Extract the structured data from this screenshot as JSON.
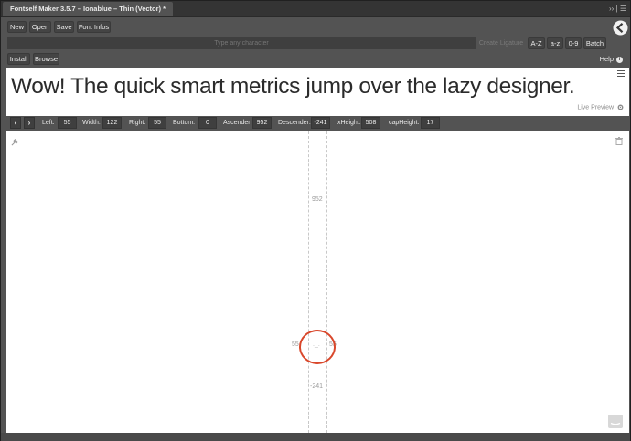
{
  "window": {
    "tab_title": "Fontself Maker 3.5.7 – Ionablue – Thin (Vector) *",
    "tab_controls": "›› | ☰"
  },
  "toolbar": {
    "new_label": "New",
    "open_label": "Open",
    "save_label": "Save",
    "font_infos_label": "Font Infos"
  },
  "character_bar": {
    "placeholder": "Type any character",
    "ligature_label": "Create Ligature",
    "az_label": "A-Z",
    "az_lower_label": "a-z",
    "digits_label": "0-9",
    "batch_label": "Batch"
  },
  "actions": {
    "install_label": "Install",
    "browse_label": "Browse",
    "help_label": "Help"
  },
  "preview": {
    "text": "Wow! The quick smart metrics jump over the lazy designer.",
    "live_preview_label": "Live Preview"
  },
  "metrics": {
    "prev_glyph": "‹",
    "next_glyph": "›",
    "left_label": "Left:",
    "left_value": "55",
    "width_label": "Width:",
    "width_value": "122",
    "right_label": "Right:",
    "right_value": "55",
    "bottom_label": "Bottom:",
    "bottom_value": "0",
    "ascender_label": "Ascender:",
    "ascender_value": "952",
    "descender_label": "Descender:",
    "descender_value": "-241",
    "xheight_label": "xHeight:",
    "xheight_value": "508",
    "capheight_label": "capHeight:",
    "capheight_value": "17"
  },
  "canvas": {
    "ascender_marker": "952",
    "descender_marker": "-241",
    "left_bearing_marker": "55",
    "right_bearing_marker": "55",
    "glyph_text": "._."
  },
  "colors": {
    "highlight_circle": "#d9472b",
    "panel_bg": "#535353"
  },
  "icons": {
    "logo": "fontself-logo-icon",
    "help": "info-icon",
    "settings": "gear-icon",
    "trash": "trash-icon",
    "pin": "pin-icon",
    "chat": "chat-icon",
    "menu": "hamburger-menu-icon"
  }
}
